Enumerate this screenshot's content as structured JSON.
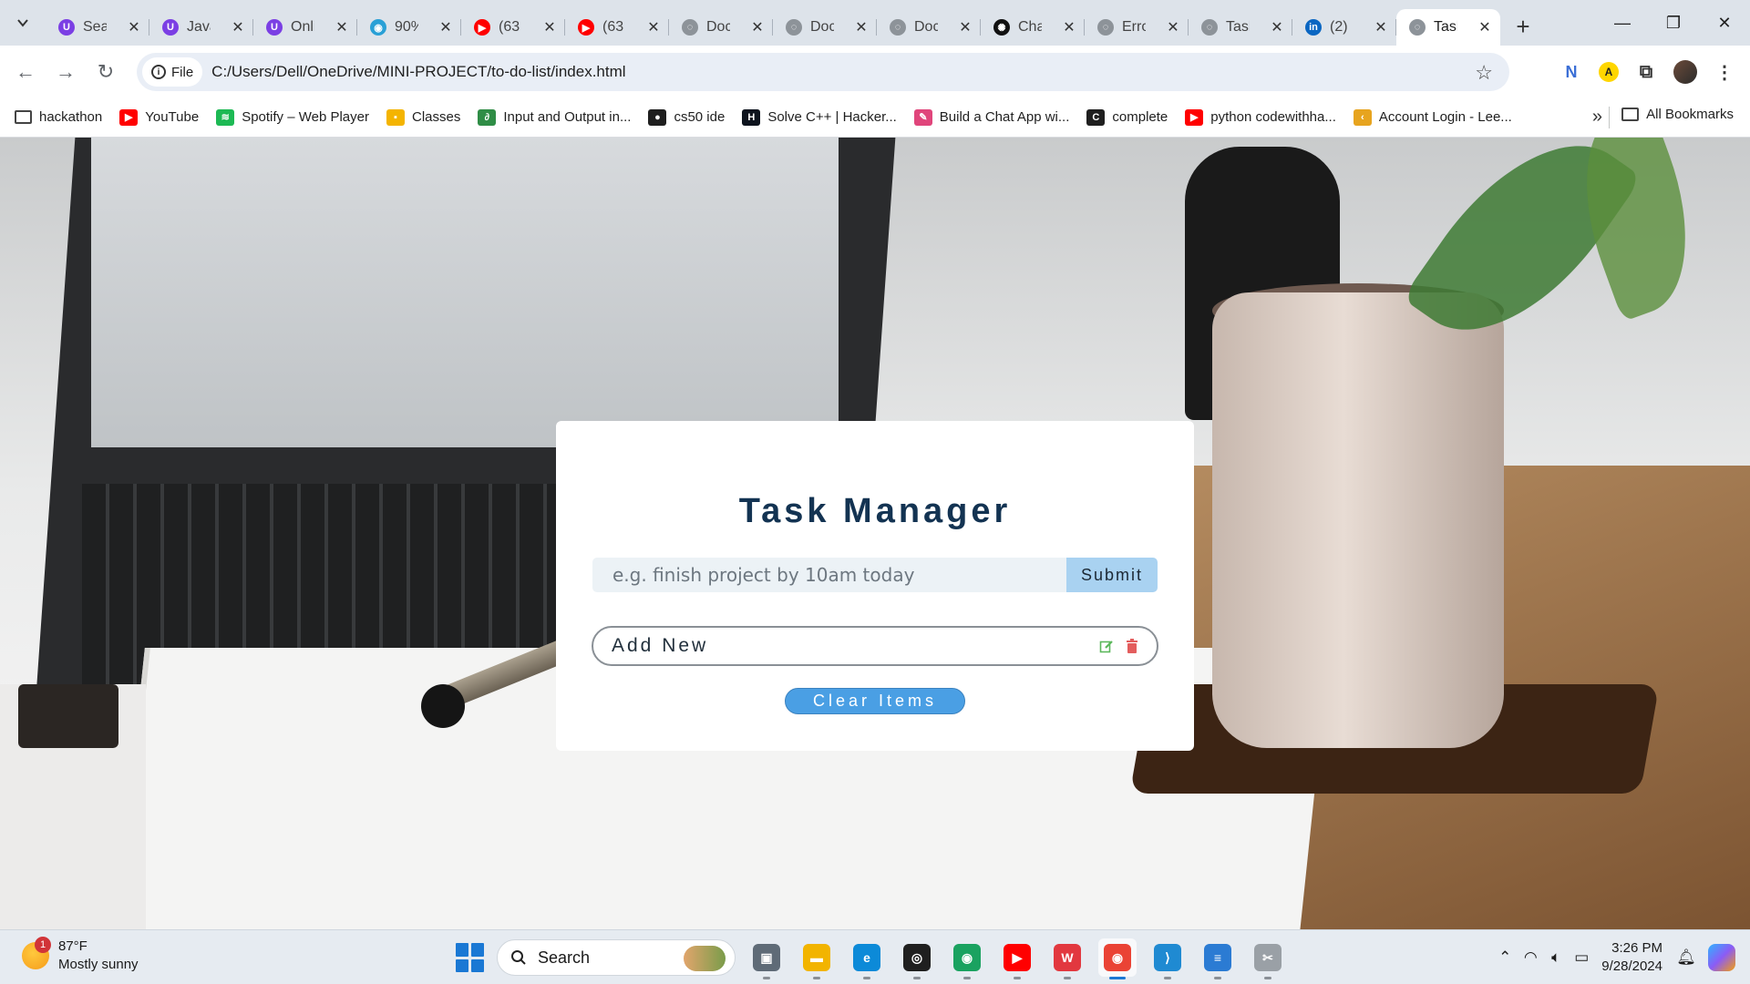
{
  "browser": {
    "tabs": [
      {
        "title": "Sear",
        "icon": "u-icon",
        "color": "#7b3fe4",
        "glyph": "U",
        "active": false
      },
      {
        "title": "Java",
        "icon": "u-icon",
        "color": "#7b3fe4",
        "glyph": "U",
        "active": false
      },
      {
        "title": "Onli",
        "icon": "u-icon",
        "color": "#7b3fe4",
        "glyph": "U",
        "active": false
      },
      {
        "title": "90%",
        "icon": "location-pin-icon",
        "color": "#29a0d6",
        "glyph": "◉",
        "active": false
      },
      {
        "title": "(63",
        "icon": "youtube-icon",
        "color": "#ff0000",
        "glyph": "▶",
        "active": false
      },
      {
        "title": "(63",
        "icon": "youtube-icon",
        "color": "#ff0000",
        "glyph": "▶",
        "active": false
      },
      {
        "title": "Doc",
        "icon": "globe-icon",
        "color": "#8d9399",
        "glyph": "◌",
        "active": false
      },
      {
        "title": "Doc",
        "icon": "globe-icon",
        "color": "#8d9399",
        "glyph": "◌",
        "active": false
      },
      {
        "title": "Doc",
        "icon": "globe-icon",
        "color": "#8d9399",
        "glyph": "◌",
        "active": false
      },
      {
        "title": "Cha",
        "icon": "chatgpt-icon",
        "color": "#111111",
        "glyph": "✺",
        "active": false
      },
      {
        "title": "Erro",
        "icon": "globe-icon",
        "color": "#8d9399",
        "glyph": "◌",
        "active": false
      },
      {
        "title": "Task",
        "icon": "globe-icon",
        "color": "#8d9399",
        "glyph": "◌",
        "active": false
      },
      {
        "title": "(2)",
        "icon": "linkedin-icon",
        "color": "#0a66c2",
        "glyph": "in",
        "active": false
      },
      {
        "title": "Task",
        "icon": "globe-icon",
        "color": "#8d9399",
        "glyph": "◌",
        "active": true
      }
    ],
    "address": {
      "chip_label": "File",
      "url": "C:/Users/Dell/OneDrive/MINI-PROJECT/to-do-list/index.html"
    },
    "bookmarks": [
      {
        "label": "hackathon",
        "icon": "folder-icon",
        "color": "#444444",
        "glyph": "▭"
      },
      {
        "label": "YouTube",
        "icon": "youtube-icon",
        "color": "#ff0000",
        "glyph": "▶"
      },
      {
        "label": "Spotify – Web Player",
        "icon": "spotify-icon",
        "color": "#1db954",
        "glyph": "≋"
      },
      {
        "label": "Classes",
        "icon": "google-classroom-icon",
        "color": "#f4b400",
        "glyph": "▪"
      },
      {
        "label": "Input and Output in...",
        "icon": "geeksforgeeks-icon",
        "color": "#2f8d46",
        "glyph": "∂"
      },
      {
        "label": "cs50 ide",
        "icon": "github-icon",
        "color": "#1f1f1f",
        "glyph": "●"
      },
      {
        "label": "Solve C++ | Hacker...",
        "icon": "hackerrank-icon",
        "color": "#0e141e",
        "glyph": "H"
      },
      {
        "label": "Build a Chat App wi...",
        "icon": "feather-icon",
        "color": "#e0457b",
        "glyph": "✎"
      },
      {
        "label": "complete",
        "icon": "c-square-icon",
        "color": "#1f1f1f",
        "glyph": "C"
      },
      {
        "label": "python codewithha...",
        "icon": "youtube-icon",
        "color": "#ff0000",
        "glyph": "▶"
      },
      {
        "label": "Account Login - Lee...",
        "icon": "leetcode-icon",
        "color": "#e7a41f",
        "glyph": "‹"
      }
    ],
    "all_bookmarks_label": "All Bookmarks"
  },
  "app": {
    "title": "Task Manager",
    "input_placeholder": "e.g. finish project by 10am today",
    "submit_label": "Submit",
    "items": [
      {
        "text": "Add New"
      }
    ],
    "clear_label": "Clear Items",
    "colors": {
      "title": "#133352",
      "edit": "#5cb85c",
      "delete": "#e35d5d",
      "clear_button": "#4a9fe4"
    }
  },
  "taskbar": {
    "weather": {
      "temp": "87°F",
      "condition": "Mostly sunny",
      "badge": "1"
    },
    "search_label": "Search",
    "apps": [
      {
        "name": "task-view-icon",
        "color": "#5f6b77",
        "glyph": "▣",
        "active": false
      },
      {
        "name": "file-explorer-icon",
        "color": "#f2b400",
        "glyph": "▬",
        "active": false
      },
      {
        "name": "edge-icon",
        "color": "#0c8ad8",
        "glyph": "e",
        "active": false
      },
      {
        "name": "github-desktop-icon",
        "color": "#1f1f1f",
        "glyph": "◎",
        "active": false
      },
      {
        "name": "chrome-icon",
        "color": "#1aa260",
        "glyph": "◉",
        "active": false
      },
      {
        "name": "youtube-icon",
        "color": "#ff0000",
        "glyph": "▶",
        "active": false
      },
      {
        "name": "wps-office-icon",
        "color": "#e2383f",
        "glyph": "W",
        "active": false
      },
      {
        "name": "chrome-profile-icon",
        "color": "#ea4335",
        "glyph": "◉",
        "active": true
      },
      {
        "name": "vscode-icon",
        "color": "#1f8ad2",
        "glyph": "⟩",
        "active": false
      },
      {
        "name": "notepad-icon",
        "color": "#2b7bd3",
        "glyph": "≡",
        "active": false
      },
      {
        "name": "snipping-tool-icon",
        "color": "#9aa0a6",
        "glyph": "✂",
        "active": false
      }
    ],
    "clock": {
      "time": "3:26 PM",
      "date": "9/28/2024"
    }
  }
}
